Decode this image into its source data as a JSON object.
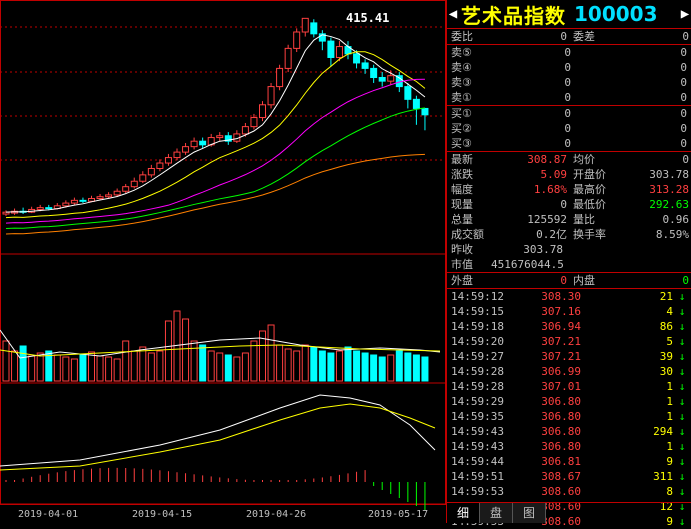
{
  "header": {
    "name": "艺术品指数",
    "code": "100003"
  },
  "peak_label": "415.41",
  "x_labels": [
    "2019-04-01",
    "2019-04-15",
    "2019-04-26",
    "2019-05-17"
  ],
  "wb": {
    "weibi_label": "委比",
    "weibi_val": "0",
    "weicha_label": "委差",
    "weicha_val": "0"
  },
  "sell": [
    {
      "label": "卖⑤",
      "price": "0",
      "vol": "0"
    },
    {
      "label": "卖④",
      "price": "0",
      "vol": "0"
    },
    {
      "label": "卖③",
      "price": "0",
      "vol": "0"
    },
    {
      "label": "卖①",
      "price": "0",
      "vol": "0"
    }
  ],
  "buy": [
    {
      "label": "买①",
      "price": "0",
      "vol": "0"
    },
    {
      "label": "买②",
      "price": "0",
      "vol": "0"
    },
    {
      "label": "买③",
      "price": "0",
      "vol": "0"
    }
  ],
  "quote": [
    {
      "l1": "最新",
      "v1": "308.87",
      "c1": "r",
      "l2": "均价",
      "v2": "0",
      "c2": "w"
    },
    {
      "l1": "涨跌",
      "v1": "5.09",
      "c1": "r",
      "l2": "开盘价",
      "v2": "303.78",
      "c2": "w"
    },
    {
      "l1": "幅度",
      "v1": "1.68%",
      "c1": "r",
      "l2": "最高价",
      "v2": "313.28",
      "c2": "r"
    },
    {
      "l1": "现量",
      "v1": "0",
      "c1": "w",
      "l2": "最低价",
      "v2": "292.63",
      "c2": "g"
    },
    {
      "l1": "总量",
      "v1": "125592",
      "c1": "w",
      "l2": "量比",
      "v2": "0.96",
      "c2": "w"
    },
    {
      "l1": "成交额",
      "v1": "0.2亿",
      "c1": "w",
      "l2": "换手率",
      "v2": "8.59%",
      "c2": "w"
    }
  ],
  "zuoshou": {
    "label": "昨收",
    "val": "303.78"
  },
  "shizhi": {
    "label": "市值",
    "val": "451676044.5"
  },
  "panel": {
    "waipan_label": "外盘",
    "waipan_val": "0",
    "neipan_label": "内盘",
    "neipan_val": "0"
  },
  "ticks": [
    {
      "t": "14:59:12",
      "p": "308.30",
      "v": "21"
    },
    {
      "t": "14:59:15",
      "p": "307.16",
      "v": "4"
    },
    {
      "t": "14:59:18",
      "p": "306.94",
      "v": "86"
    },
    {
      "t": "14:59:20",
      "p": "307.21",
      "v": "5"
    },
    {
      "t": "14:59:27",
      "p": "307.21",
      "v": "39"
    },
    {
      "t": "14:59:28",
      "p": "306.99",
      "v": "30"
    },
    {
      "t": "14:59:28",
      "p": "307.01",
      "v": "1"
    },
    {
      "t": "14:59:29",
      "p": "306.80",
      "v": "1"
    },
    {
      "t": "14:59:35",
      "p": "306.80",
      "v": "1"
    },
    {
      "t": "14:59:43",
      "p": "306.80",
      "v": "294"
    },
    {
      "t": "14:59:43",
      "p": "306.80",
      "v": "1"
    },
    {
      "t": "14:59:44",
      "p": "306.81",
      "v": "9"
    },
    {
      "t": "14:59:51",
      "p": "308.67",
      "v": "311"
    },
    {
      "t": "14:59:53",
      "p": "308.60",
      "v": "8"
    },
    {
      "t": "14:59:53",
      "p": "308.60",
      "v": "12"
    },
    {
      "t": "14:59:53",
      "p": "308.60",
      "v": "9"
    }
  ],
  "tabs": [
    "细",
    "盘",
    "图"
  ],
  "colors": {
    "up": "#ff4040",
    "down": "#00ffff",
    "grid": "#c00000"
  }
}
